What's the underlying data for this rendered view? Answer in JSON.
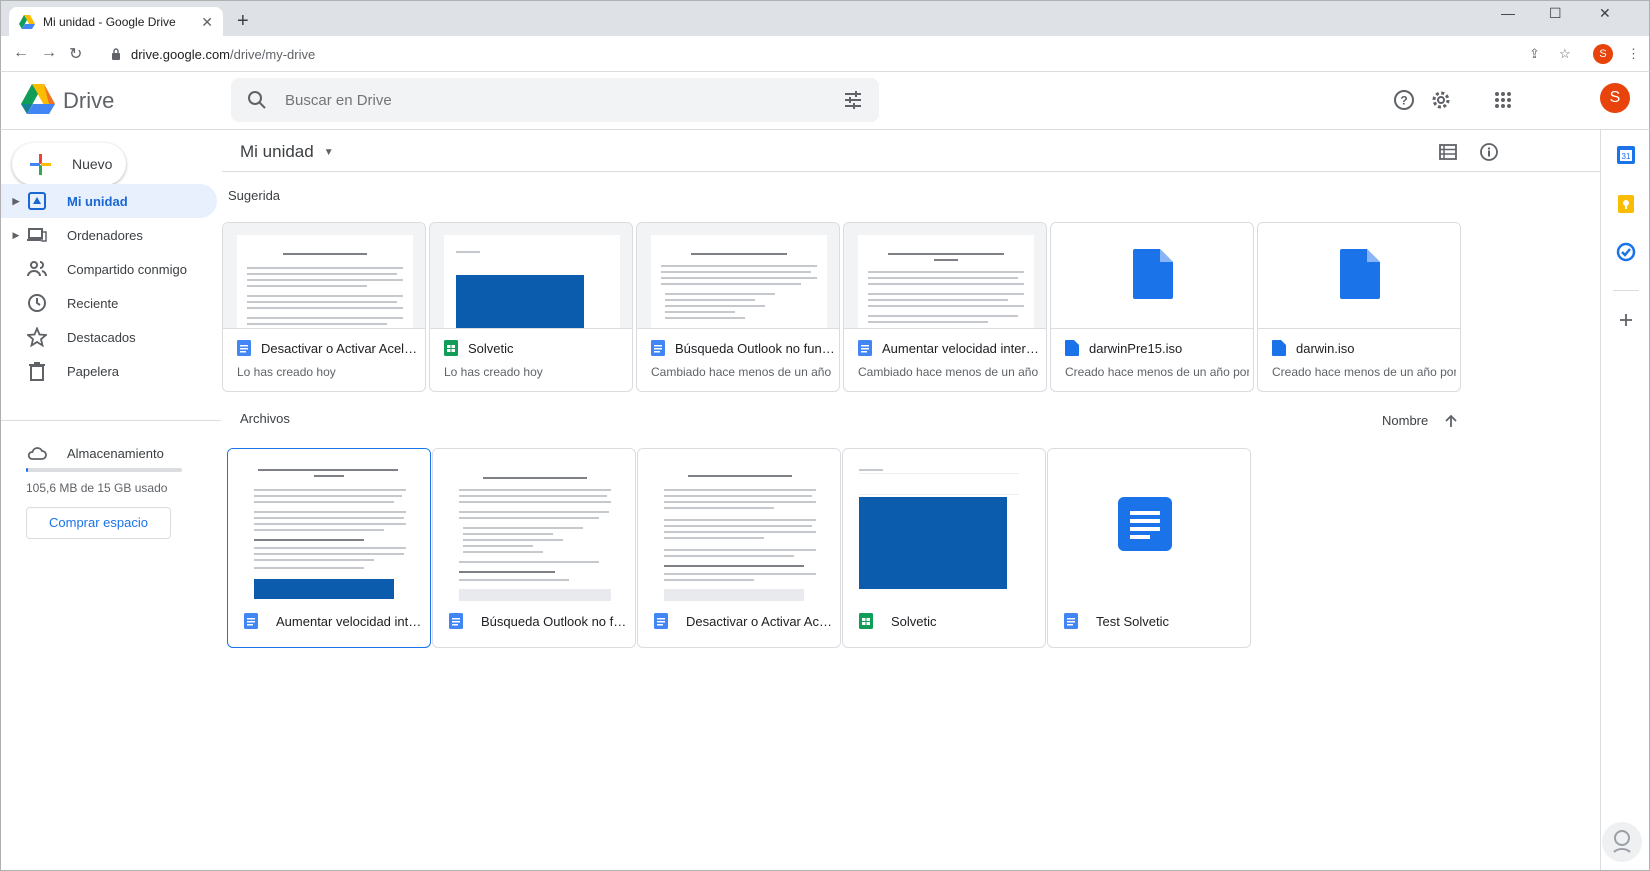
{
  "browser": {
    "tab_title": "Mi unidad - Google Drive",
    "url_host": "drive.google.com",
    "url_path": "/drive/my-drive",
    "profile_initial": "S"
  },
  "header": {
    "brand": "Drive",
    "search_placeholder": "Buscar en Drive",
    "avatar_initial": "S"
  },
  "sidebar": {
    "new_label": "Nuevo",
    "items": [
      {
        "label": "Mi unidad",
        "icon": "drive-icon",
        "active": true
      },
      {
        "label": "Ordenadores",
        "icon": "computers-icon"
      },
      {
        "label": "Compartido conmigo",
        "icon": "shared-icon"
      },
      {
        "label": "Reciente",
        "icon": "clock-icon"
      },
      {
        "label": "Destacados",
        "icon": "star-icon"
      },
      {
        "label": "Papelera",
        "icon": "trash-icon"
      },
      {
        "label": "Almacenamiento",
        "icon": "cloud-icon"
      }
    ],
    "storage_text": "105,6 MB de 15 GB usado",
    "storage_fraction": 0.007,
    "buy_label": "Comprar espacio"
  },
  "main": {
    "title": "Mi unidad",
    "suggested_label": "Sugerida",
    "files_label": "Archivos",
    "sort_label": "Nombre",
    "suggested": [
      {
        "name": "Desactivar o Activar Acele...",
        "sub": "Lo has creado hoy",
        "type": "doc"
      },
      {
        "name": "Solvetic",
        "sub": "Lo has creado hoy",
        "type": "sheet"
      },
      {
        "name": "Búsqueda Outlook no func...",
        "sub": "Cambiado hace menos de un año ...",
        "type": "doc"
      },
      {
        "name": "Aumentar velocidad intern...",
        "sub": "Cambiado hace menos de un año ...",
        "type": "doc"
      },
      {
        "name": "darwinPre15.iso",
        "sub": "Creado hace menos de un año por ti",
        "type": "file"
      },
      {
        "name": "darwin.iso",
        "sub": "Creado hace menos de un año por ti",
        "type": "file"
      }
    ],
    "files": [
      {
        "name": "Aumentar velocidad inter...",
        "type": "doc"
      },
      {
        "name": "Búsqueda Outlook no fun...",
        "type": "doc"
      },
      {
        "name": "Desactivar o Activar Acel...",
        "type": "doc"
      },
      {
        "name": "Solvetic",
        "type": "sheet"
      },
      {
        "name": "Test Solvetic",
        "type": "doc"
      }
    ]
  },
  "colors": {
    "accent": "#1a73e8",
    "doc_blue": "#4285f4",
    "sheet_green": "#0f9d58",
    "selection_bg": "#e8f0fe"
  }
}
